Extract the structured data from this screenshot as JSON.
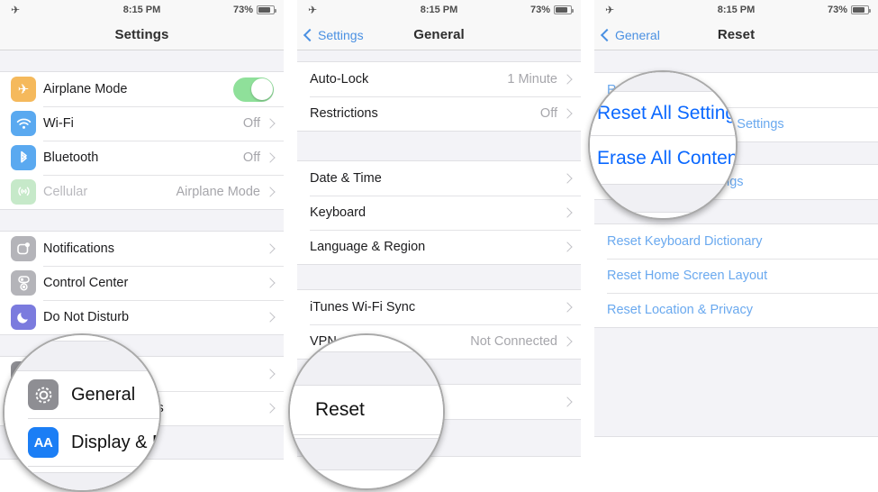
{
  "status_bar": {
    "airplane_icon": "airplane-icon",
    "time": "8:15 PM",
    "battery_percent": "73%",
    "battery_level": 73
  },
  "panels": [
    {
      "id": "settings",
      "nav": {
        "title": "Settings",
        "back_label": null
      },
      "groups": [
        {
          "rows": [
            {
              "icon": "airplane-icon",
              "icon_color": "#f5b95c",
              "label": "Airplane Mode",
              "control": "toggle",
              "toggle_on": true
            },
            {
              "icon": "wifi-icon",
              "icon_color": "#5aa9f0",
              "label": "Wi-Fi",
              "value": "Off",
              "control": "chevron"
            },
            {
              "icon": "bluetooth-icon",
              "icon_color": "#5aa9f0",
              "label": "Bluetooth",
              "value": "Off",
              "control": "chevron"
            },
            {
              "icon": "cellular-icon",
              "icon_color": "#c6e9c9",
              "label": "Cellular",
              "value": "Airplane Mode",
              "control": "chevron",
              "dim": true
            }
          ]
        },
        {
          "rows": [
            {
              "icon": "notifications-icon",
              "icon_color": "#b4b4b9",
              "label": "Notifications",
              "control": "chevron"
            },
            {
              "icon": "control-center-icon",
              "icon_color": "#b4b4b9",
              "label": "Control Center",
              "control": "chevron"
            },
            {
              "icon": "do-not-disturb-icon",
              "icon_color": "#7b7bde",
              "label": "Do Not Disturb",
              "control": "chevron"
            }
          ]
        },
        {
          "rows": [
            {
              "icon": "gear-icon",
              "icon_color": "#8e8e93",
              "label": "General",
              "control": "chevron"
            },
            {
              "icon": "display-brightness-icon",
              "icon_color": "#1b7ef5",
              "label": "Display & Brightness",
              "control": "chevron"
            }
          ]
        }
      ]
    },
    {
      "id": "general",
      "nav": {
        "title": "General",
        "back_label": "Settings"
      },
      "groups": [
        {
          "rows": [
            {
              "label": "Auto-Lock",
              "value": "1 Minute",
              "control": "chevron"
            },
            {
              "label": "Restrictions",
              "value": "Off",
              "control": "chevron"
            }
          ]
        },
        {
          "rows": [
            {
              "label": "Date & Time",
              "control": "chevron"
            },
            {
              "label": "Keyboard",
              "control": "chevron"
            },
            {
              "label": "Language & Region",
              "control": "chevron"
            }
          ]
        },
        {
          "rows": [
            {
              "label": "iTunes Wi-Fi Sync",
              "control": "chevron"
            },
            {
              "label": "VPN",
              "value": "Not Connected",
              "control": "chevron"
            }
          ]
        },
        {
          "rows": [
            {
              "label": "Reset",
              "control": "chevron"
            }
          ]
        }
      ]
    },
    {
      "id": "reset",
      "nav": {
        "title": "Reset",
        "back_label": "General"
      },
      "groups": [
        {
          "rows": [
            {
              "label": "Reset All Settings",
              "link": true
            },
            {
              "label": "Erase All Content and Settings",
              "link": true
            }
          ]
        },
        {
          "rows": [
            {
              "label": "Reset Network Settings",
              "link": true
            }
          ]
        },
        {
          "rows": [
            {
              "label": "Reset Keyboard Dictionary",
              "link": true
            },
            {
              "label": "Reset Home Screen Layout",
              "link": true
            },
            {
              "label": "Reset Location & Privacy",
              "link": true
            }
          ]
        }
      ]
    }
  ],
  "loupes": [
    {
      "id": "loupe-general",
      "panel": "settings",
      "highlight": [
        "General",
        "Display & Brightness"
      ],
      "rows": [
        {
          "icon": "gear-icon",
          "icon_color": "#8e8e93",
          "label": "General"
        },
        {
          "icon": "display-brightness-icon",
          "icon_color": "#1b7ef5",
          "label": "Display & Brightness"
        }
      ]
    },
    {
      "id": "loupe-reset",
      "panel": "general",
      "highlight": [
        "Reset"
      ],
      "rows": [
        {
          "label": "Reset"
        }
      ]
    },
    {
      "id": "loupe-erase",
      "panel": "reset",
      "highlight": [
        "Reset All Settings",
        "Erase All Content and Settings"
      ],
      "rows": [
        {
          "label": "Reset All Settings",
          "link": true
        },
        {
          "label": "Erase All Content and Settings",
          "link": true
        }
      ]
    }
  ],
  "colors": {
    "ios_blue": "#007aff",
    "nav_blue": "#4a90e2",
    "list_bg": "#f3f3f7",
    "separator": "#e3e3e6",
    "toggle_green": "#8fe09a"
  }
}
